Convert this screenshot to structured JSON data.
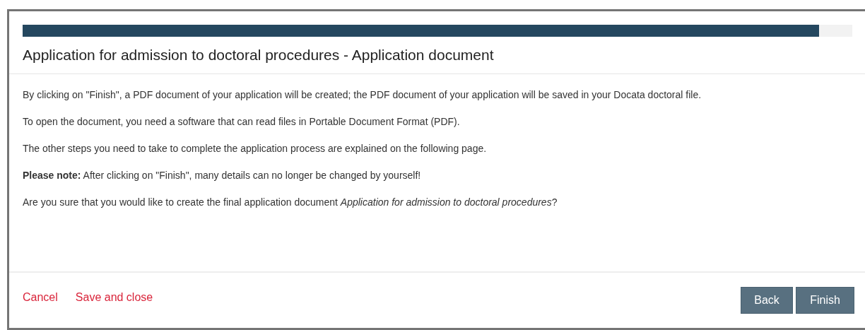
{
  "progress": {
    "level": 0.96
  },
  "title": "Application for admission to doctoral procedures - Application document",
  "paragraphs": [
    "By clicking on \"Finish\", a PDF document of your application will be created; the PDF document of your application will be saved in your Docata doctoral file.",
    "To open the document, you need a software that can read files in Portable Document Format (PDF).",
    "The other steps you need to take to complete the application process are explained on the following page.",
    "**Please note:** After clicking on \"Finish\", many details can no longer be changed by yourself!",
    "Are you sure that you would like to create the final application document *Application for admission to doctoral procedures*?"
  ],
  "links": [
    "Cancel",
    "Save and close"
  ],
  "buttons": [
    "Back",
    "Finish"
  ]
}
